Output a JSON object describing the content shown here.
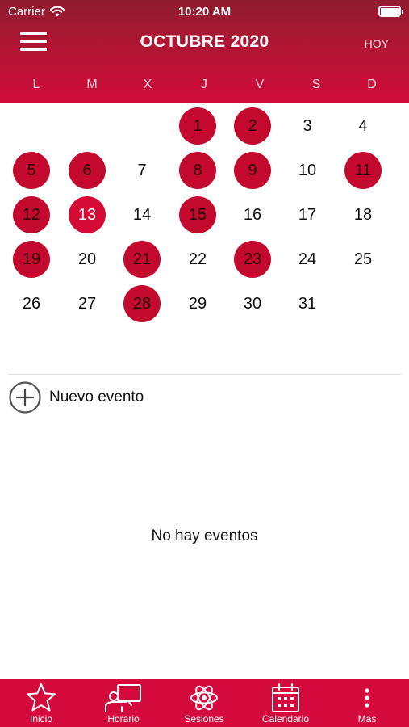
{
  "status_bar": {
    "carrier": "Carrier",
    "time": "10:20 AM"
  },
  "header": {
    "title": "OCTUBRE 2020",
    "today_label": "HOY"
  },
  "weekdays": [
    "L",
    "M",
    "X",
    "J",
    "V",
    "S",
    "D"
  ],
  "calendar": {
    "weeks": [
      [
        {
          "d": ""
        },
        {
          "d": ""
        },
        {
          "d": ""
        },
        {
          "d": "1",
          "e": true
        },
        {
          "d": "2",
          "e": true
        },
        {
          "d": "3"
        },
        {
          "d": "4"
        }
      ],
      [
        {
          "d": "5",
          "e": true
        },
        {
          "d": "6",
          "e": true
        },
        {
          "d": "7"
        },
        {
          "d": "8",
          "e": true
        },
        {
          "d": "9",
          "e": true
        },
        {
          "d": "10"
        },
        {
          "d": "11",
          "e": true
        }
      ],
      [
        {
          "d": "12",
          "e": true
        },
        {
          "d": "13",
          "t": true
        },
        {
          "d": "14"
        },
        {
          "d": "15",
          "e": true
        },
        {
          "d": "16"
        },
        {
          "d": "17"
        },
        {
          "d": "18"
        }
      ],
      [
        {
          "d": "19",
          "e": true
        },
        {
          "d": "20"
        },
        {
          "d": "21",
          "e": true
        },
        {
          "d": "22"
        },
        {
          "d": "23",
          "e": true
        },
        {
          "d": "24"
        },
        {
          "d": "25"
        }
      ],
      [
        {
          "d": "26"
        },
        {
          "d": "27"
        },
        {
          "d": "28",
          "e": true
        },
        {
          "d": "29"
        },
        {
          "d": "30"
        },
        {
          "d": "31"
        },
        {
          "d": ""
        }
      ]
    ]
  },
  "new_event": {
    "label": "Nuevo evento"
  },
  "empty_state": "No hay eventos",
  "tabbar": {
    "items": [
      {
        "label": "Inicio",
        "icon": "star-icon"
      },
      {
        "label": "Horario",
        "icon": "teacher-board-icon"
      },
      {
        "label": "Sesiones",
        "icon": "atom-icon"
      },
      {
        "label": "Calendario",
        "icon": "calendar-icon"
      },
      {
        "label": "Más",
        "icon": "more-vertical-icon"
      }
    ]
  },
  "colors": {
    "header_top": "#8e1c2f",
    "accent": "#d30a3b",
    "event_circle": "#c4092e"
  }
}
